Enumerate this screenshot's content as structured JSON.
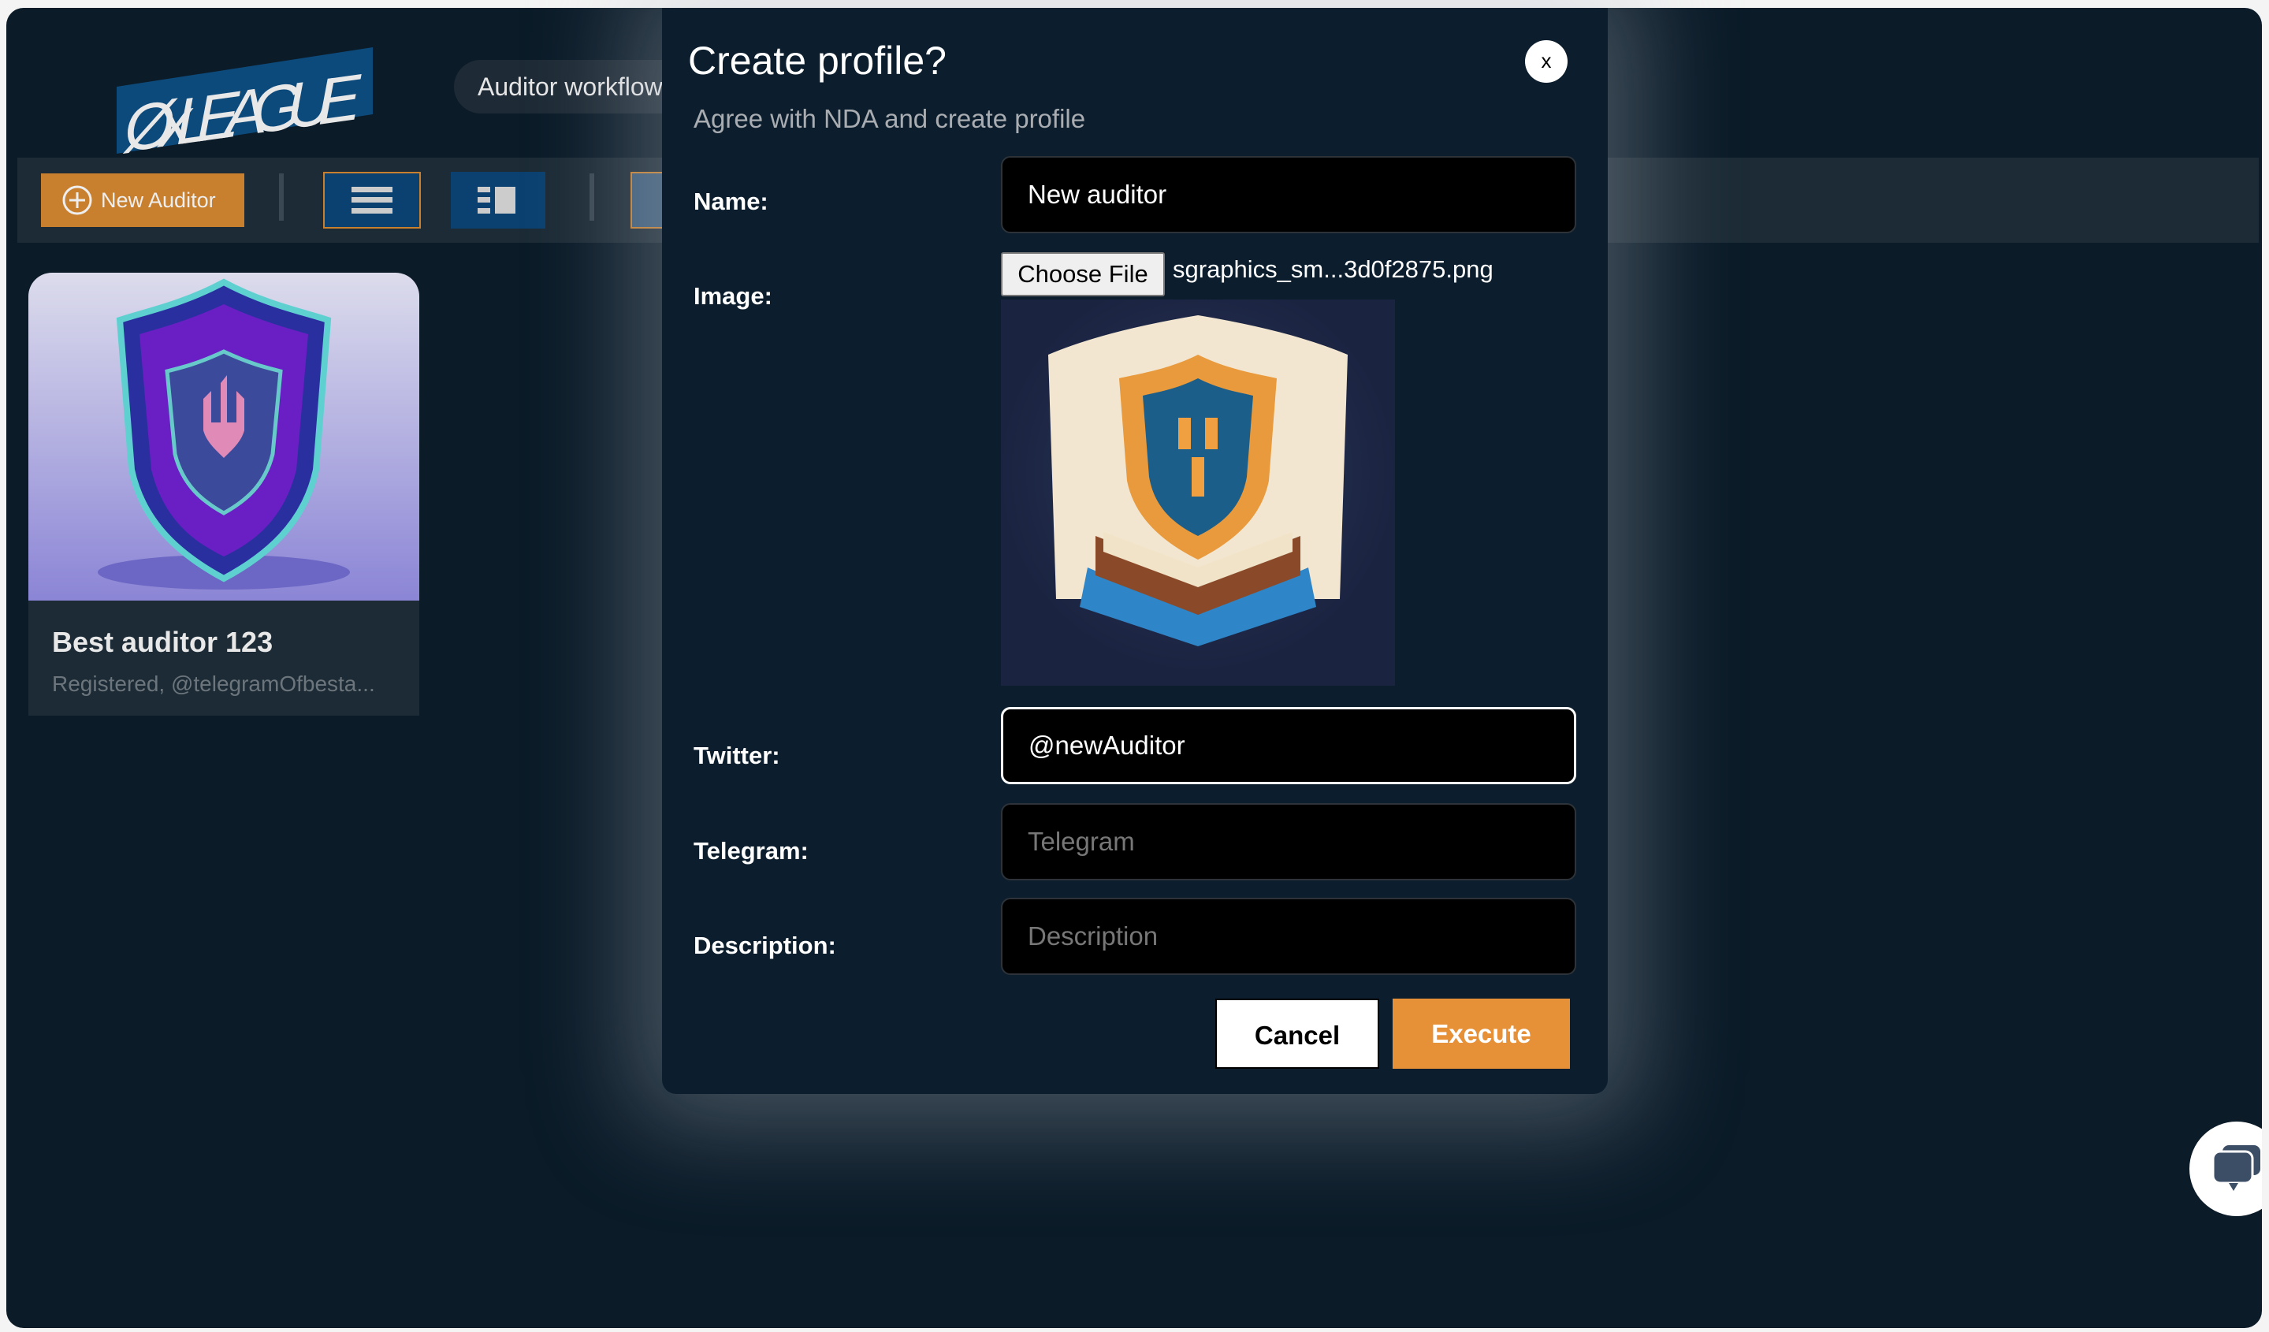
{
  "header": {
    "logo_text": "0xLEAGUE",
    "nav_pill": "Auditor workflow"
  },
  "toolbar": {
    "new_auditor_label": "New Auditor",
    "view_list_icon": "list-icon",
    "view_grid_icon": "grid-icon"
  },
  "auditors": [
    {
      "name": "Best auditor 123",
      "subtitle": "Registered, @telegramOfbesta..."
    }
  ],
  "modal": {
    "title": "Create profile?",
    "close_label": "x",
    "subtitle": "Agree with NDA and create profile",
    "fields": {
      "name": {
        "label": "Name:",
        "value": "New auditor"
      },
      "image": {
        "label": "Image:",
        "button": "Choose File",
        "filename": "sgraphics_sm...3d0f2875.png"
      },
      "twitter": {
        "label": "Twitter:",
        "value": "@newAuditor"
      },
      "telegram": {
        "label": "Telegram:",
        "placeholder": "Telegram"
      },
      "description": {
        "label": "Description:",
        "placeholder": "Description"
      }
    },
    "cancel_label": "Cancel",
    "execute_label": "Execute"
  },
  "colors": {
    "accent": "#e69138",
    "background": "#0b1b28",
    "button_blue": "#0b4170"
  }
}
